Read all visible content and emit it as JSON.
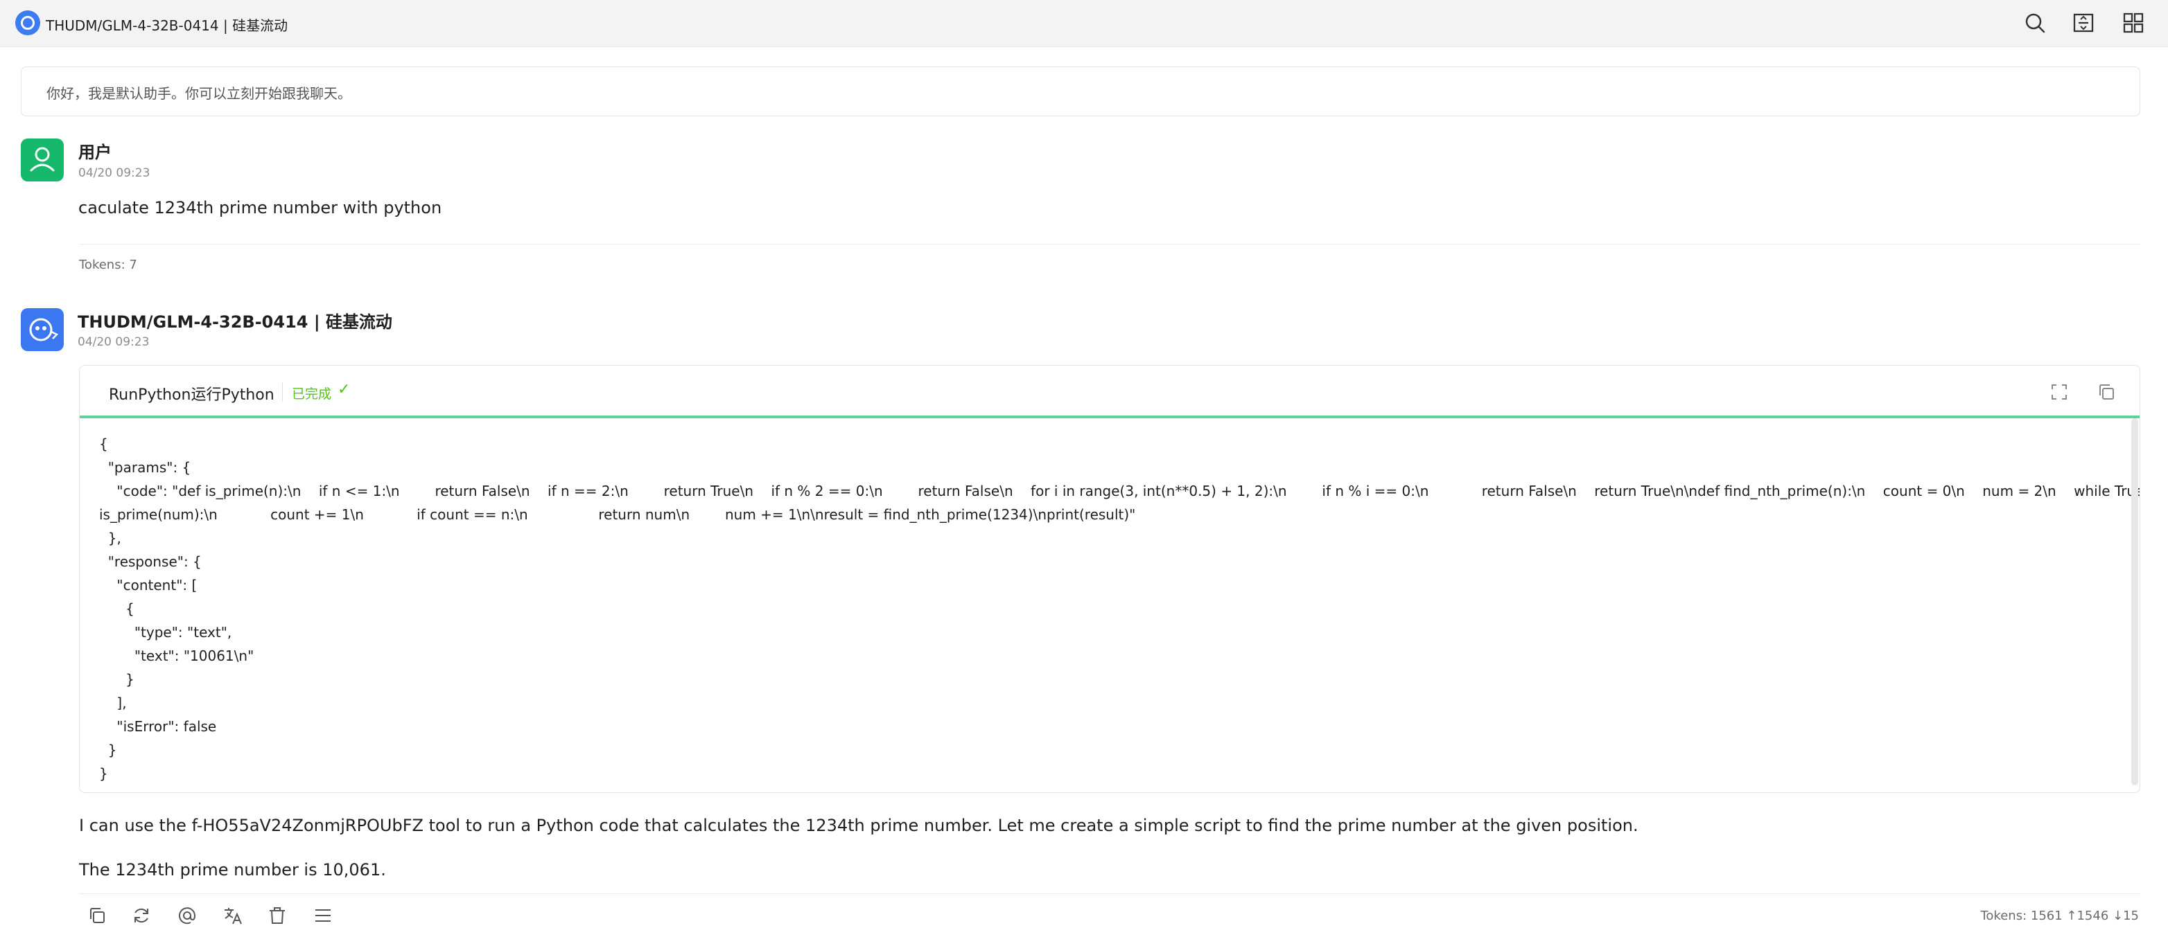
{
  "window": {
    "title": "THUDM/GLM-4-32B-0414 | 硅基流动"
  },
  "topbar_icons": [
    "search-icon",
    "expand-panel-icon",
    "grid-icon"
  ],
  "welcome": {
    "text": "你好，我是默认助手。你可以立刻开始跟我聊天。"
  },
  "user_message": {
    "author": "用户",
    "timestamp": "04/20 09:23",
    "text": "caculate 1234th prime number with python",
    "tokens": "Tokens: 7"
  },
  "assistant_message": {
    "author": "THUDM/GLM-4-32B-0414 | 硅基流动",
    "timestamp": "04/20 09:23",
    "tool": {
      "name": "RunPython运行Python",
      "status": "已完成",
      "status_mark": "✓",
      "code_lines": [
        "{",
        "  \"params\": {",
        "    \"code\": \"def is_prime(n):\\n    if n <= 1:\\n        return False\\n    if n == 2:\\n        return True\\n    if n % 2 == 0:\\n        return False\\n    for i in range(3, int(n**0.5) + 1, 2):\\n        if n % i == 0:\\n            return False\\n    return True\\n\\ndef find_nth_prime(n):\\n    count = 0\\n    num = 2\\n    while True:\\n        if",
        "is_prime(num):\\n            count += 1\\n            if count == n:\\n                return num\\n        num += 1\\n\\nresult = find_nth_prime(1234)\\nprint(result)\"",
        "  },",
        "  \"response\": {",
        "    \"content\": [",
        "      {",
        "        \"type\": \"text\",",
        "        \"text\": \"10061\\n\"",
        "      }",
        "    ],",
        "    \"isError\": false",
        "  }",
        "}"
      ]
    },
    "paragraph1": "I can use the f-HO55aV24ZonmjRPOUbFZ tool to run a Python code that calculates the 1234th prime number. Let me create a simple script to find the prime number at the given position.",
    "paragraph2": "The 1234th prime number is 10,061.",
    "tokens": "Tokens: 1561 ↑1546 ↓15"
  },
  "action_icons": [
    "copy-icon",
    "regenerate-icon",
    "mention-icon",
    "translate-icon",
    "delete-icon",
    "menu-icon"
  ],
  "colors": {
    "user_avatar": "#16b86b",
    "bot_avatar": "#3a77f0",
    "status_green": "#52c41a",
    "tool_accent": "#5fd19b"
  }
}
